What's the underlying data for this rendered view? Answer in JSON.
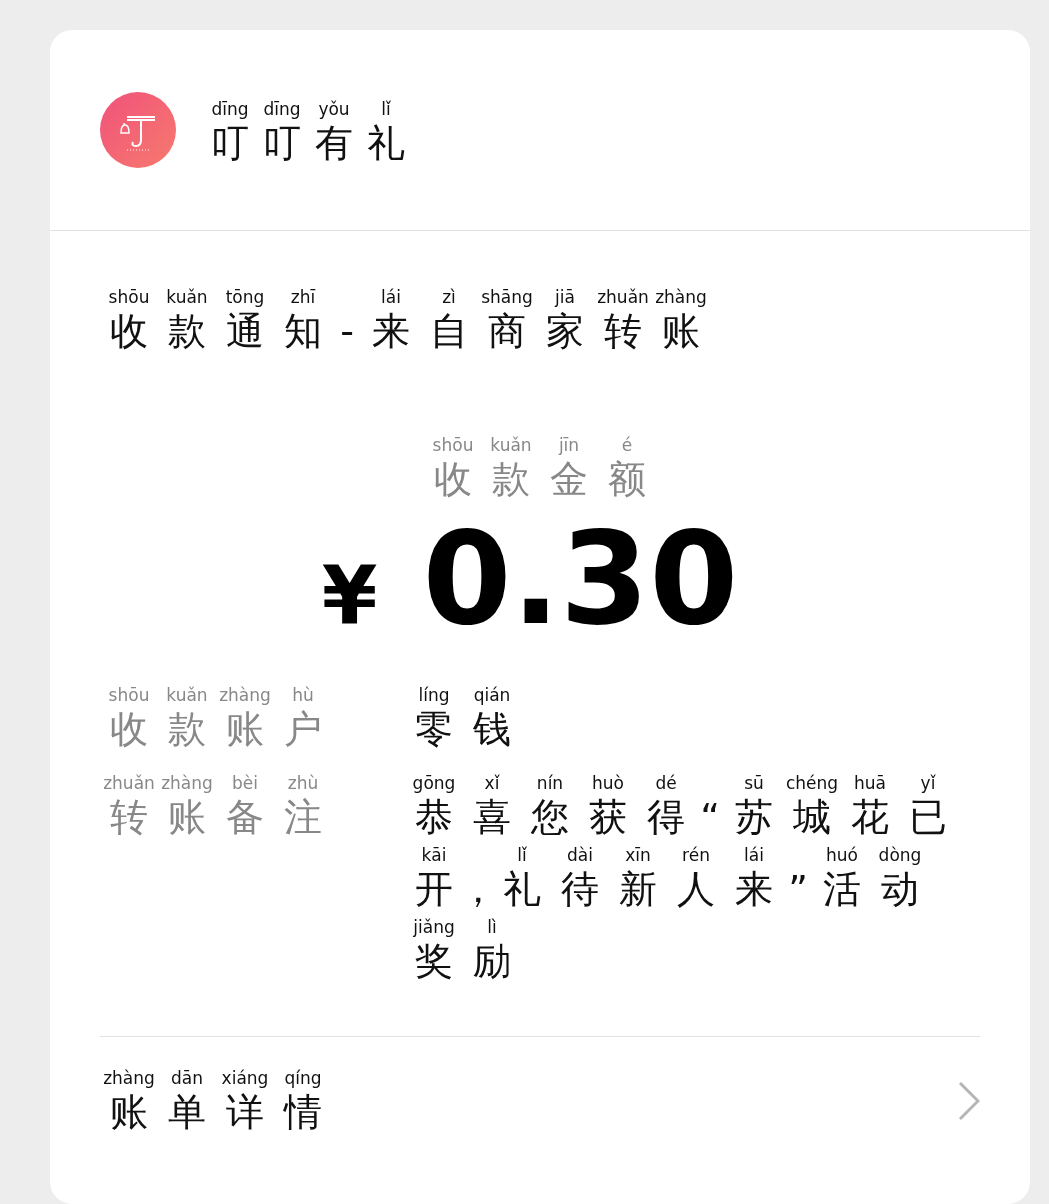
{
  "header": {
    "app_name": [
      {
        "hanzi": "叮",
        "pinyin": "dīng"
      },
      {
        "hanzi": "叮",
        "pinyin": "dīng"
      },
      {
        "hanzi": "有",
        "pinyin": "yǒu"
      },
      {
        "hanzi": "礼",
        "pinyin": "lǐ"
      }
    ]
  },
  "title": [
    {
      "hanzi": "收",
      "pinyin": "shōu"
    },
    {
      "hanzi": "款",
      "pinyin": "kuǎn"
    },
    {
      "hanzi": "通",
      "pinyin": "tōng"
    },
    {
      "hanzi": "知",
      "pinyin": "zhī"
    },
    {
      "hanzi": "-"
    },
    {
      "hanzi": "来",
      "pinyin": "lái"
    },
    {
      "hanzi": "自",
      "pinyin": "zì"
    },
    {
      "hanzi": "商",
      "pinyin": "shāng"
    },
    {
      "hanzi": "家",
      "pinyin": "jiā"
    },
    {
      "hanzi": "转",
      "pinyin": "zhuǎn"
    },
    {
      "hanzi": "账",
      "pinyin": "zhàng"
    }
  ],
  "amount_label": [
    {
      "hanzi": "收",
      "pinyin": "shōu"
    },
    {
      "hanzi": "款",
      "pinyin": "kuǎn"
    },
    {
      "hanzi": "金",
      "pinyin": "jīn"
    },
    {
      "hanzi": "额",
      "pinyin": "é"
    }
  ],
  "amount": {
    "currency": "¥",
    "value": "0.30"
  },
  "details": [
    {
      "label": [
        {
          "hanzi": "收",
          "pinyin": "shōu"
        },
        {
          "hanzi": "款",
          "pinyin": "kuǎn"
        },
        {
          "hanzi": "账",
          "pinyin": "zhàng"
        },
        {
          "hanzi": "户",
          "pinyin": "hù"
        }
      ],
      "value": [
        {
          "hanzi": "零",
          "pinyin": "líng"
        },
        {
          "hanzi": "钱",
          "pinyin": "qián"
        }
      ]
    },
    {
      "label": [
        {
          "hanzi": "转",
          "pinyin": "zhuǎn"
        },
        {
          "hanzi": "账",
          "pinyin": "zhàng"
        },
        {
          "hanzi": "备",
          "pinyin": "bèi"
        },
        {
          "hanzi": "注",
          "pinyin": "zhù"
        }
      ],
      "value": [
        {
          "hanzi": "恭",
          "pinyin": "gōng"
        },
        {
          "hanzi": "喜",
          "pinyin": "xǐ"
        },
        {
          "hanzi": "您",
          "pinyin": "nín"
        },
        {
          "hanzi": "获",
          "pinyin": "huò"
        },
        {
          "hanzi": "得",
          "pinyin": "dé"
        },
        {
          "hanzi": "“"
        },
        {
          "hanzi": "苏",
          "pinyin": "sū"
        },
        {
          "hanzi": "城",
          "pinyin": "chéng"
        },
        {
          "hanzi": "花",
          "pinyin": "huā"
        },
        {
          "hanzi": "已",
          "pinyin": "yǐ"
        },
        {
          "hanzi": "开",
          "pinyin": "kāi"
        },
        {
          "hanzi": "，"
        },
        {
          "hanzi": "礼",
          "pinyin": "lǐ"
        },
        {
          "hanzi": "待",
          "pinyin": "dài"
        },
        {
          "hanzi": "新",
          "pinyin": "xīn"
        },
        {
          "hanzi": "人",
          "pinyin": "rén"
        },
        {
          "hanzi": "来",
          "pinyin": "lái"
        },
        {
          "hanzi": "”"
        },
        {
          "hanzi": "活",
          "pinyin": "huó"
        },
        {
          "hanzi": "动",
          "pinyin": "dòng"
        },
        {
          "hanzi": "奖",
          "pinyin": "jiǎng"
        },
        {
          "hanzi": "励",
          "pinyin": "lì"
        }
      ]
    }
  ],
  "footer_link": [
    {
      "hanzi": "账",
      "pinyin": "zhàng"
    },
    {
      "hanzi": "单",
      "pinyin": "dān"
    },
    {
      "hanzi": "详",
      "pinyin": "xiáng"
    },
    {
      "hanzi": "情",
      "pinyin": "qíng"
    }
  ]
}
